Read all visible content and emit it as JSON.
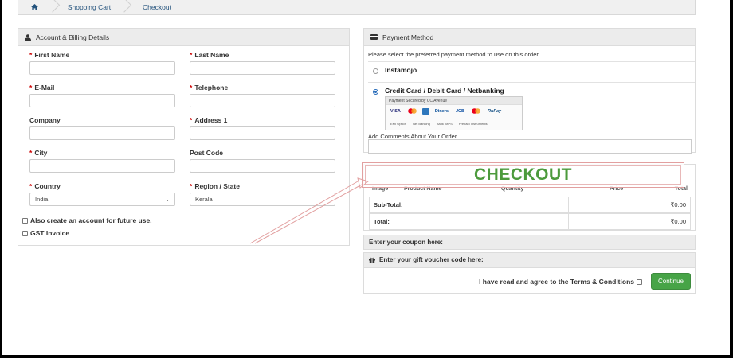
{
  "breadcrumb": {
    "items": [
      "Shopping Cart",
      "Checkout"
    ]
  },
  "billing": {
    "title": "Account & Billing Details",
    "fields": [
      {
        "label": "First Name",
        "required": true,
        "value": ""
      },
      {
        "label": "Last Name",
        "required": true,
        "value": ""
      },
      {
        "label": "E-Mail",
        "required": true,
        "value": ""
      },
      {
        "label": "Telephone",
        "required": true,
        "value": ""
      },
      {
        "label": "Company",
        "required": false,
        "value": ""
      },
      {
        "label": "Address 1",
        "required": true,
        "value": ""
      },
      {
        "label": "City",
        "required": true,
        "value": ""
      },
      {
        "label": "Post Code",
        "required": false,
        "value": ""
      },
      {
        "label": "Country",
        "required": true,
        "value": "India"
      },
      {
        "label": "Region / State",
        "required": true,
        "value": "Kerala"
      }
    ],
    "create_account_label": "Also create an account for future use.",
    "gst_label": "GST Invoice"
  },
  "payment": {
    "title": "Payment Method",
    "instructions": "Please select the preferred payment method to use on this order.",
    "options": [
      {
        "label": "Instamojo",
        "selected": false
      },
      {
        "label": "Credit Card / Debit Card / Netbanking",
        "selected": true
      }
    ],
    "secured_by": "Payment Secured by CC Avenue",
    "card_brands": [
      "VISA",
      "MC",
      "AMEX",
      "Diners",
      "JCB",
      "MC",
      "RuPay"
    ],
    "card_brand_colors": [
      "#1a1f71",
      "#eb001b",
      "#2e77bc",
      "#004a97",
      "#0b4ea2",
      "#f79e1b",
      "#0f4c81"
    ],
    "methods": [
      "EMI Option",
      "Net Banking",
      "Bank IMPS",
      "Prepaid Instruments"
    ],
    "comments_label": "Add Comments About Your Order"
  },
  "order": {
    "overlay_text": "CHECKOUT",
    "overlay_color": "#4c9a3c",
    "columns": [
      "Image",
      "Product Name",
      "Quantity",
      "Price",
      "Total"
    ],
    "rows": [
      {
        "label": "Sub-Total:",
        "value": "₹0.00"
      },
      {
        "label": "Total:",
        "value": "₹0.00"
      }
    ]
  },
  "coupon_label": "Enter your coupon here:",
  "voucher_label": "Enter your gift voucher code here:",
  "agree_label": "I have read and agree to the Terms & Conditions",
  "continue_label": "Continue",
  "accent_color": "#47a447"
}
